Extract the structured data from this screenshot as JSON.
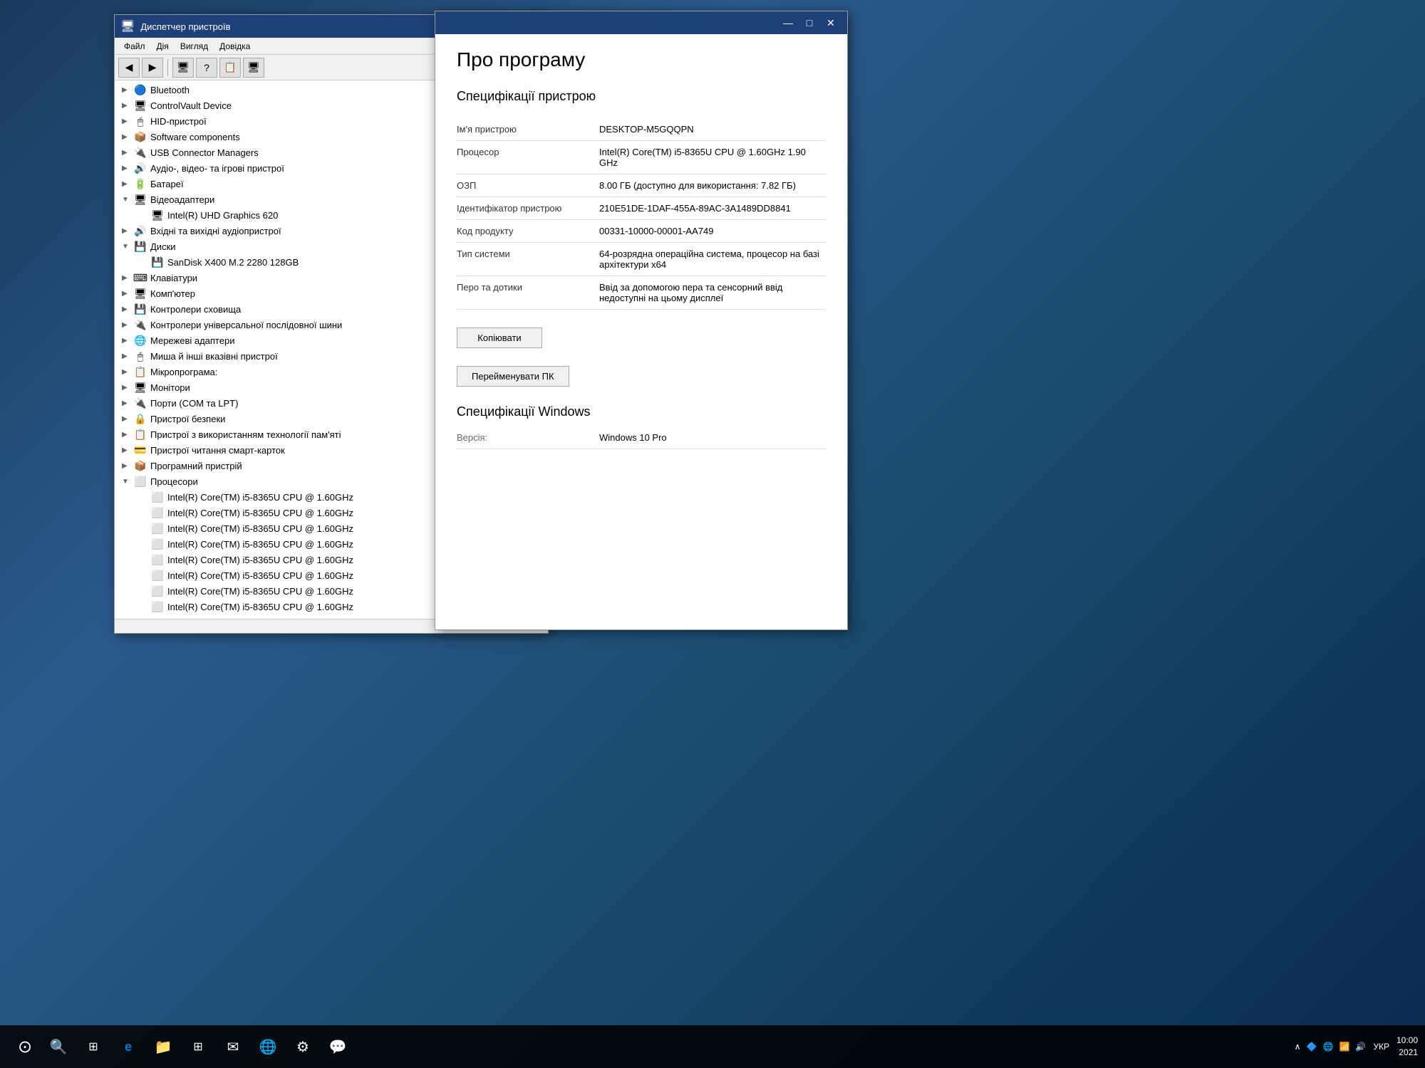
{
  "desktop": {
    "background": "blue-nature"
  },
  "devmgr": {
    "title": "Диспетчер пристроїв",
    "menu": {
      "file": "Файл",
      "action": "Дія",
      "view": "Вигляд",
      "help": "Довідка"
    },
    "toolbar": {
      "back": "◀",
      "forward": "▶",
      "icon1": "🖥",
      "help": "?",
      "icon2": "📋",
      "icon3": "🖥"
    },
    "tree_items": [
      {
        "label": "Bluetooth",
        "icon": "🔵",
        "indent": 0,
        "expand": "▶"
      },
      {
        "label": "ControlVault Device",
        "icon": "🖥",
        "indent": 0,
        "expand": "▶"
      },
      {
        "label": "HID-пристрої",
        "icon": "🖱",
        "indent": 0,
        "expand": "▶"
      },
      {
        "label": "Software components",
        "icon": "📦",
        "indent": 0,
        "expand": "▶"
      },
      {
        "label": "USB Connector Managers",
        "icon": "🔌",
        "indent": 0,
        "expand": "▶"
      },
      {
        "label": "Аудіо-, відео- та ігрові пристрої",
        "icon": "🔊",
        "indent": 0,
        "expand": "▶"
      },
      {
        "label": "Батареї",
        "icon": "🔋",
        "indent": 0,
        "expand": "▶"
      },
      {
        "label": "Відеоадаптери",
        "icon": "🖥",
        "indent": 0,
        "expand": "▼"
      },
      {
        "label": "Intel(R) UHD Graphics 620",
        "icon": "🖥",
        "indent": 1,
        "expand": ""
      },
      {
        "label": "Вхідні та вихідні аудіопристрої",
        "icon": "🔊",
        "indent": 0,
        "expand": "▶"
      },
      {
        "label": "Диски",
        "icon": "💾",
        "indent": 0,
        "expand": "▼"
      },
      {
        "label": "SanDisk X400 M.2 2280 128GB",
        "icon": "💾",
        "indent": 1,
        "expand": ""
      },
      {
        "label": "Клавіатури",
        "icon": "⌨",
        "indent": 0,
        "expand": "▶"
      },
      {
        "label": "Комп'ютер",
        "icon": "🖥",
        "indent": 0,
        "expand": "▶"
      },
      {
        "label": "Контролери сховища",
        "icon": "💾",
        "indent": 0,
        "expand": "▶"
      },
      {
        "label": "Контролери універсальної послідовної шини",
        "icon": "🔌",
        "indent": 0,
        "expand": "▶"
      },
      {
        "label": "Мережеві адаптери",
        "icon": "🌐",
        "indent": 0,
        "expand": "▶"
      },
      {
        "label": "Миша й інші вказівні пристрої",
        "icon": "🖱",
        "indent": 0,
        "expand": "▶"
      },
      {
        "label": "Мікропрограма:",
        "icon": "📋",
        "indent": 0,
        "expand": "▶"
      },
      {
        "label": "Монітори",
        "icon": "🖥",
        "indent": 0,
        "expand": "▶"
      },
      {
        "label": "Порти (COM та LPT)",
        "icon": "🔌",
        "indent": 0,
        "expand": "▶"
      },
      {
        "label": "Пристрої безпеки",
        "icon": "🔒",
        "indent": 0,
        "expand": "▶"
      },
      {
        "label": "Пристрої з використанням технології пам'яті",
        "icon": "📋",
        "indent": 0,
        "expand": "▶"
      },
      {
        "label": "Пристрої читання смарт-карток",
        "icon": "💳",
        "indent": 0,
        "expand": "▶"
      },
      {
        "label": "Програмний пристрій",
        "icon": "📦",
        "indent": 0,
        "expand": "▶"
      },
      {
        "label": "Процесори",
        "icon": "⬜",
        "indent": 0,
        "expand": "▼"
      },
      {
        "label": "Intel(R) Core(TM) i5-8365U CPU @ 1.60GHz",
        "icon": "⬜",
        "indent": 1,
        "expand": ""
      },
      {
        "label": "Intel(R) Core(TM) i5-8365U CPU @ 1.60GHz",
        "icon": "⬜",
        "indent": 1,
        "expand": ""
      },
      {
        "label": "Intel(R) Core(TM) i5-8365U CPU @ 1.60GHz",
        "icon": "⬜",
        "indent": 1,
        "expand": ""
      },
      {
        "label": "Intel(R) Core(TM) i5-8365U CPU @ 1.60GHz",
        "icon": "⬜",
        "indent": 1,
        "expand": ""
      },
      {
        "label": "Intel(R) Core(TM) i5-8365U CPU @ 1.60GHz",
        "icon": "⬜",
        "indent": 1,
        "expand": ""
      },
      {
        "label": "Intel(R) Core(TM) i5-8365U CPU @ 1.60GHz",
        "icon": "⬜",
        "indent": 1,
        "expand": ""
      },
      {
        "label": "Intel(R) Core(TM) i5-8365U CPU @ 1.60GHz",
        "icon": "⬜",
        "indent": 1,
        "expand": ""
      },
      {
        "label": "Intel(R) Core(TM) i5-8365U CPU @ 1.60GHz",
        "icon": "⬜",
        "indent": 1,
        "expand": ""
      }
    ]
  },
  "about": {
    "titlebar_controls": [
      "—",
      "□",
      "✕"
    ],
    "page_title": "Про програму",
    "device_specs_title": "Специфікації пристрою",
    "specs": [
      {
        "label": "Ім'я пристрою",
        "value": "DESKTOP-M5GQQPN"
      },
      {
        "label": "Процесор",
        "value": "Intel(R) Core(TM) i5-8365U CPU @ 1.60GHz  1.90 GHz"
      },
      {
        "label": "ОЗП",
        "value": "8.00 ГБ (доступно для використання: 7.82 ГБ)"
      },
      {
        "label": "Ідентифікатор пристрою",
        "value": "210E51DE-1DAF-455A-89AC-3A1489DD8841"
      },
      {
        "label": "Код продукту",
        "value": "00331-10000-00001-AA749"
      },
      {
        "label": "Тип системи",
        "value": "64-розрядна операційна система, процесор на базі архітектури x64"
      },
      {
        "label": "Перо та дотики",
        "value": "Ввід за допомогою пера та сенсорний ввід недоступні на цьому дисплеї"
      }
    ],
    "copy_btn": "Копіювати",
    "rename_btn": "Перейменувати ПК",
    "windows_specs_title": "Специфікації Windows",
    "windows_version_label": "Версія:",
    "windows_version_value": "Windows 10 Pro"
  },
  "taskbar": {
    "start_icon": "⊙",
    "time": "10:0",
    "language": "УКР",
    "icons": [
      "⊙",
      "⊞",
      "e",
      "📁",
      "⊞",
      "✉",
      "🌐",
      "⚙",
      "💬"
    ]
  }
}
